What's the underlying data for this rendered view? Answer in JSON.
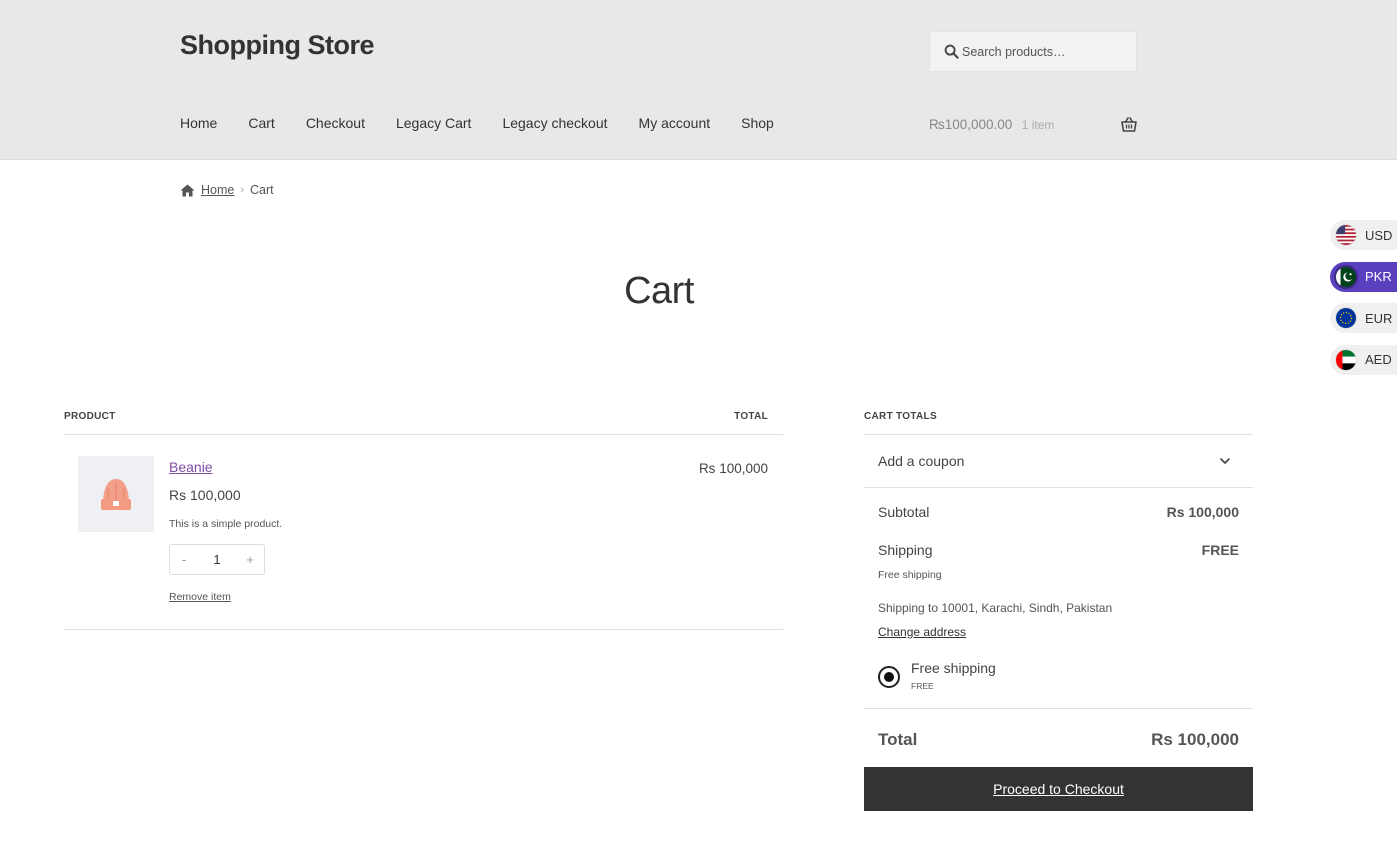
{
  "header": {
    "site_title": "Shopping Store",
    "search_placeholder": "Search products…",
    "nav": [
      "Home",
      "Cart",
      "Checkout",
      "Legacy Cart",
      "Legacy checkout",
      "My account",
      "Shop"
    ],
    "mini_cart": {
      "amount": "₨100,000.00",
      "count": "1 item"
    }
  },
  "breadcrumb": {
    "home": "Home",
    "current": "Cart"
  },
  "currencies": [
    {
      "code": "USD",
      "active": false
    },
    {
      "code": "PKR",
      "active": true
    },
    {
      "code": "EUR",
      "active": false
    },
    {
      "code": "AED",
      "active": false
    }
  ],
  "colors": {
    "accent": "#5a3fbf",
    "link": "#7e4ea4",
    "button": "#333333",
    "header_bg": "#e8e8e8"
  },
  "page_title": "Cart",
  "cart": {
    "col_product": "PRODUCT",
    "col_total": "TOTAL",
    "items": [
      {
        "name": "Beanie",
        "price": "Rs 100,000",
        "description": "This is a simple product.",
        "quantity": "1",
        "qty_minus": "-",
        "qty_plus": "+",
        "remove": "Remove item",
        "line_total": "Rs 100,000"
      }
    ]
  },
  "totals": {
    "heading": "CART TOTALS",
    "coupon": "Add a coupon",
    "subtotal_label": "Subtotal",
    "subtotal_value": "Rs 100,000",
    "shipping_label": "Shipping",
    "shipping_value": "FREE",
    "shipping_method": "Free shipping",
    "shipping_to": "Shipping to 10001, Karachi, Sindh, Pakistan",
    "change_address": "Change address",
    "option_label": "Free shipping",
    "option_price": "FREE",
    "total_label": "Total",
    "total_value": "Rs 100,000",
    "checkout": "Proceed to Checkout"
  }
}
